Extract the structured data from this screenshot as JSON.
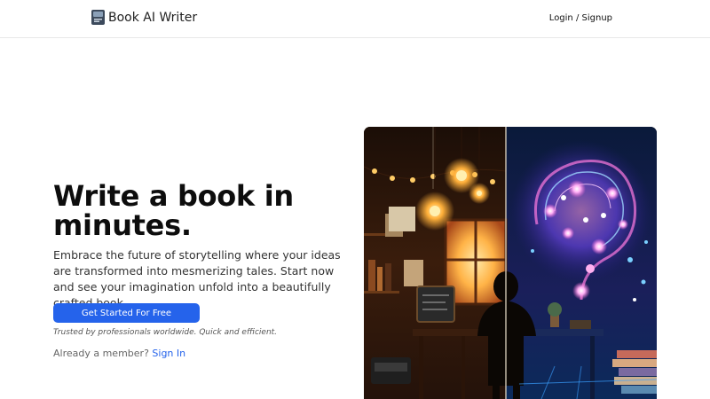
{
  "brand": {
    "name": "Book AI Writer",
    "icon": "book-logo-icon"
  },
  "nav": {
    "login_signup": "Login / Signup"
  },
  "hero": {
    "title": "Write a book in minutes.",
    "description": "Embrace the future of storytelling where your ideas are transformed into mesmerizing tales. Start now and see your imagination unfold into a beautifully crafted book.",
    "cta_label": "Get Started For Free",
    "trust_note": "Trusted by professionals worldwide. Quick and efficient.",
    "member_prompt": "Already a member?",
    "signin_label": "Sign In",
    "image_alt": "Illustration of a writer at a desk with a glowing AI brain"
  },
  "colors": {
    "accent": "#2563eb",
    "background": "#ffffff",
    "text": "#0d0d0d"
  }
}
